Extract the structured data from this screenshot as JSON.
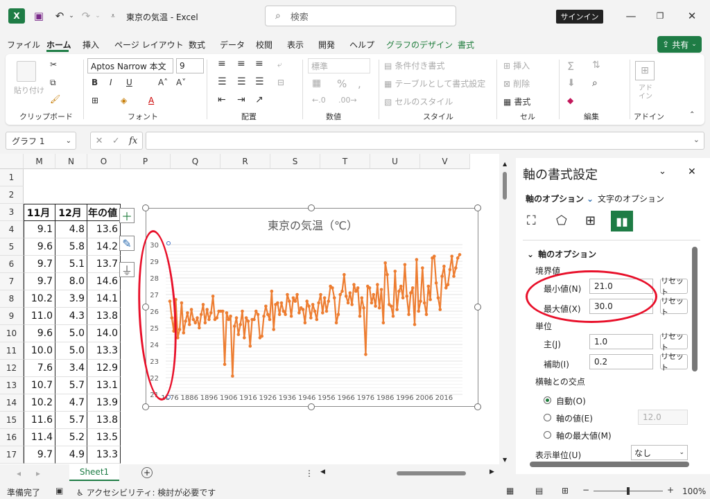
{
  "window": {
    "title": "東京の気温 - Excel",
    "search_placeholder": "検索",
    "signin": "サインイン",
    "share": "共有"
  },
  "tabs": [
    "ファイル",
    "ホーム",
    "挿入",
    "ページ レイアウト",
    "数式",
    "データ",
    "校閲",
    "表示",
    "開発",
    "ヘルプ",
    "グラフのデザイン",
    "書式"
  ],
  "ribbon": {
    "paste": "貼り付け",
    "font_name": "Aptos Narrow 本文",
    "font_size": "9",
    "number_format": "標準",
    "conditional": "条件付き書式",
    "as_table": "テーブルとして書式設定",
    "cell_style": "セルのスタイル",
    "insert": "挿入",
    "delete": "削除",
    "format": "書式",
    "addin": "アド イン",
    "groups": [
      "クリップボード",
      "フォント",
      "配置",
      "数値",
      "スタイル",
      "セル",
      "編集",
      "アドイン"
    ]
  },
  "formula_bar": {
    "name_box": "グラフ 1",
    "fx": "fx",
    "formula": ""
  },
  "columns": [
    "M",
    "N",
    "O",
    "P",
    "Q",
    "R",
    "S",
    "T",
    "U",
    "V"
  ],
  "rows": [
    "1",
    "2",
    "3",
    "4",
    "5",
    "6",
    "7",
    "8",
    "9",
    "10",
    "11",
    "12",
    "13",
    "14",
    "15",
    "16",
    "17"
  ],
  "table": {
    "headers": [
      "11月",
      "12月",
      "年の値"
    ],
    "data": [
      [
        "9.1",
        "4.8",
        "13.6"
      ],
      [
        "9.6",
        "5.8",
        "14.2"
      ],
      [
        "9.7",
        "5.1",
        "13.7"
      ],
      [
        "9.7",
        "8.0",
        "14.6"
      ],
      [
        "10.2",
        "3.9",
        "14.1"
      ],
      [
        "11.0",
        "4.3",
        "13.8"
      ],
      [
        "9.6",
        "5.0",
        "14.0"
      ],
      [
        "10.0",
        "5.0",
        "13.3"
      ],
      [
        "7.6",
        "3.4",
        "12.9"
      ],
      [
        "10.7",
        "5.7",
        "13.1"
      ],
      [
        "10.2",
        "4.7",
        "13.9"
      ],
      [
        "11.6",
        "5.7",
        "13.8"
      ],
      [
        "11.4",
        "5.2",
        "13.5"
      ],
      [
        "9.7",
        "4.9",
        "13.3"
      ]
    ]
  },
  "chart_data": {
    "type": "line",
    "title": "東京の気温（℃）",
    "ylim": [
      21,
      30
    ],
    "y_ticks": [
      "30",
      "29",
      "28",
      "27",
      "26",
      "25",
      "24",
      "23",
      "22",
      "21"
    ],
    "x_tick_labels": [
      "1876",
      "1886",
      "1896",
      "1906",
      "1916",
      "1926",
      "1936",
      "1946",
      "1956",
      "1966",
      "1976",
      "1986",
      "1996",
      "2006",
      "2016"
    ],
    "color": "#ed7d31",
    "series": [
      {
        "x_start": 1876,
        "values": [
          26.6,
          25.6,
          24.8,
          26.7,
          24.4,
          24.9,
          26.5,
          24.7,
          25.4,
          25.9,
          25.2,
          26.1,
          25.5,
          25.3,
          25.6,
          25.0,
          25.8,
          26.4,
          25.3,
          26.1,
          25.5,
          25.9,
          26.9,
          25.5,
          25.6,
          26.0,
          26.0,
          26.0,
          22.8,
          25.9,
          25.5,
          25.7,
          22.1,
          25.1,
          25.6,
          24.6,
          25.2,
          26.0,
          24.4,
          25.6,
          25.4,
          23.9,
          25.5,
          25.5,
          26.0,
          25.8,
          24.4,
          24.5,
          25.7,
          26.3,
          25.8,
          25.5,
          27.2,
          24.9,
          26.4,
          26.5,
          25.8,
          26.5,
          26.0,
          25.8,
          27.0,
          26.6,
          25.7,
          26.8,
          26.6,
          27.0,
          25.9,
          26.2,
          26.1,
          25.3,
          26.6,
          26.3,
          25.6,
          26.4,
          26.0,
          25.5,
          26.5,
          27.0,
          25.9,
          26.8,
          26.0,
          26.6,
          27.5,
          27.4,
          26.8,
          25.3,
          25.8,
          27.0,
          27.2,
          28.2,
          26.9,
          26.5,
          27.1,
          26.4,
          27.6,
          27.2,
          27.4,
          25.7,
          26.8,
          26.2,
          23.4,
          27.5,
          27.4,
          26.5,
          27.0,
          26.3,
          27.6,
          26.2,
          27.3,
          25.3,
          28.9,
          28.2,
          26.4,
          26.3,
          25.7,
          28.4,
          26.1,
          27.2,
          27.5,
          26.8,
          28.8,
          26.9,
          25.8,
          27.1,
          27.4,
          25.2,
          29.1,
          26.0,
          26.6,
          28.6,
          26.5,
          25.8,
          27.5,
          26.7,
          29.2,
          29.3,
          27.7,
          26.8,
          26.1,
          28.1,
          28.7,
          27.4,
          27.6,
          28.5,
          29.3,
          28.1,
          28.6,
          29.2,
          29.4
        ]
      }
    ]
  },
  "pane": {
    "title": "軸の書式設定",
    "tab_axis": "軸のオプション",
    "tab_text": "文字のオプション",
    "section": "軸のオプション",
    "bounds": "境界値",
    "min_label": "最小値(N)",
    "min_value": "21.0",
    "max_label": "最大値(X)",
    "max_value": "30.0",
    "units": "単位",
    "major_label": "主(J)",
    "major_value": "1.0",
    "minor_label": "補助(I)",
    "minor_value": "0.2",
    "reset": "リセット",
    "cross": "横軸との交点",
    "auto": "自動(O)",
    "axis_value": "軸の値(E)",
    "axis_value_input": "12.0",
    "axis_max": "軸の最大値(M)",
    "display_units": "表示単位(U)",
    "display_units_value": "なし"
  },
  "sheet_tab": "Sheet1",
  "status": {
    "ready": "準備完了",
    "accessibility": "アクセシビリティ: 検討が必要です",
    "zoom": "100%"
  }
}
